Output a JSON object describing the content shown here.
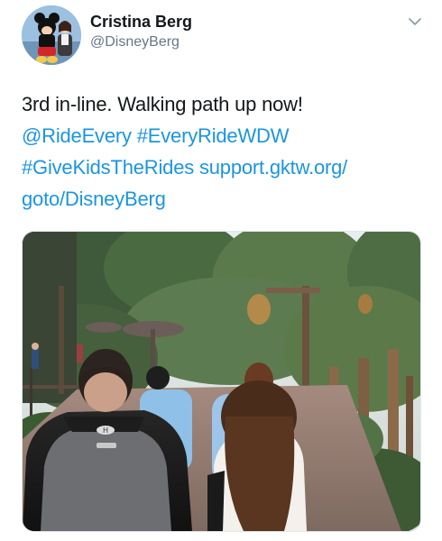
{
  "author": {
    "name": "Cristina Berg",
    "handle": "@DisneyBerg"
  },
  "tweet": {
    "text_plain": "3rd in-line. Walking path up now!",
    "mention": "@RideEvery",
    "hashtag_1": "#EveryRideWDW",
    "hashtag_2": "#GiveKidsTheRides",
    "link_part_1": "support.gktw.org/",
    "link_part_2": "goto/DisneyBerg"
  },
  "icons": {
    "more": "chevron-down-icon"
  },
  "colors": {
    "link": "#1b95e0",
    "text": "#14171a",
    "secondary": "#657786"
  },
  "media": {
    "type": "photo",
    "description_visible": false,
    "shirt_logo_text": "H"
  }
}
